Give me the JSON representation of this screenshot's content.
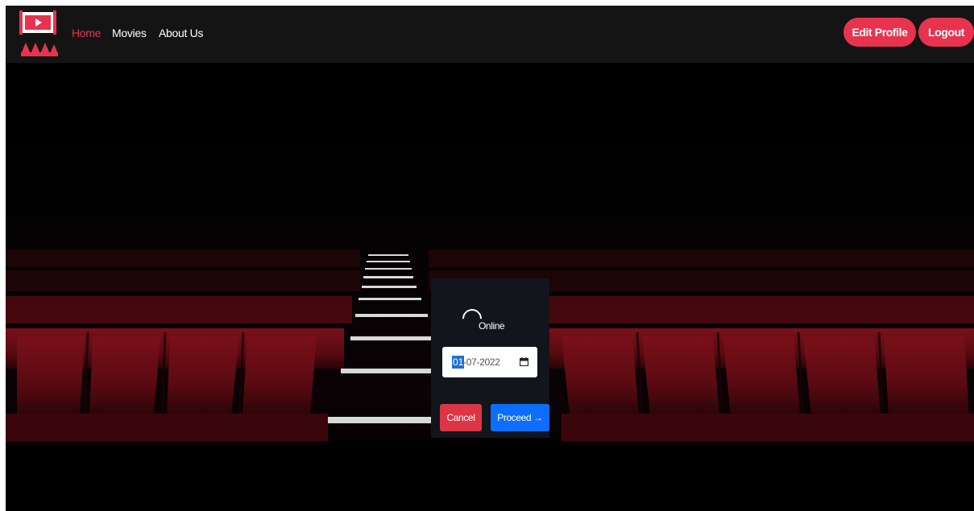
{
  "nav": {
    "links": [
      "Home",
      "Movies",
      "About Us"
    ],
    "active": "Home",
    "edit_profile": "Edit Profile",
    "logout": "Logout"
  },
  "modal": {
    "status": "Online",
    "date": {
      "day": "01",
      "rest": "-07-2022"
    },
    "cancel": "Cancel",
    "proceed": "Proceed →"
  },
  "colors": {
    "accent": "#e8334f",
    "navbar": "#141414",
    "modal_bg": "#12151b",
    "cancel": "#dc3545",
    "proceed": "#0d6efd",
    "seat": "#8a1420"
  },
  "icons": [
    "cinema-logo-icon",
    "spinner-icon",
    "calendar-icon"
  ]
}
